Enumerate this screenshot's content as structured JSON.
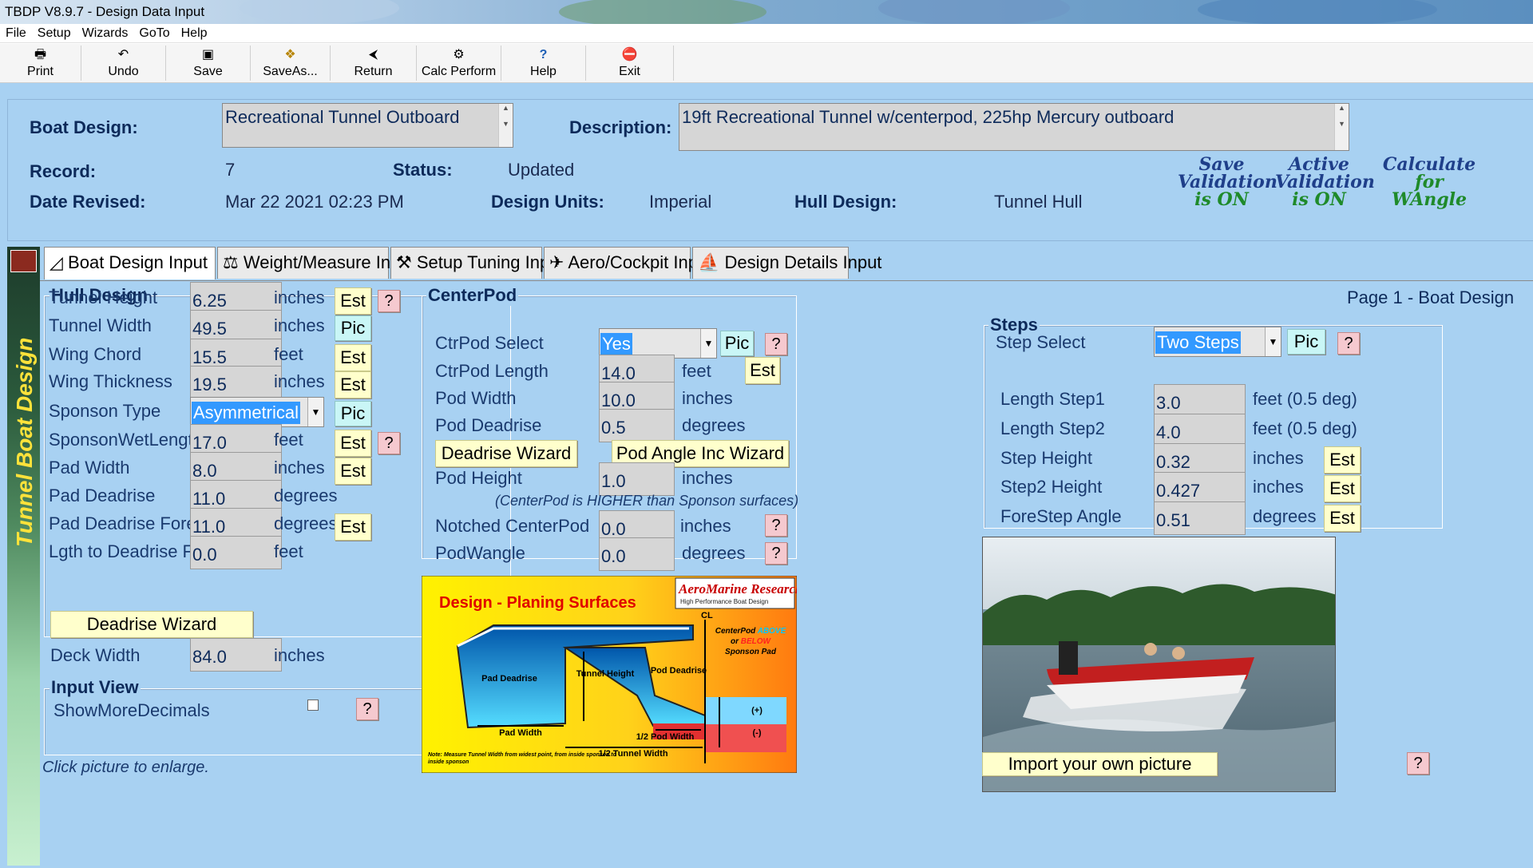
{
  "window": {
    "title": "TBDP V8.9.7 - Design Data Input"
  },
  "menu": [
    "File",
    "Setup",
    "Wizards",
    "GoTo",
    "Help"
  ],
  "toolbar": [
    {
      "label": "Print",
      "icon": "printer-icon",
      "glyph": "🖶"
    },
    {
      "label": "Undo",
      "icon": "undo-icon",
      "glyph": "↶"
    },
    {
      "label": "Save",
      "icon": "save-icon",
      "glyph": "▣"
    },
    {
      "label": "SaveAs...",
      "icon": "saveas-icon",
      "glyph": "❖"
    },
    {
      "label": "Return",
      "icon": "return-icon",
      "glyph": "⮜"
    },
    {
      "label": "Calc Perform",
      "icon": "calc-icon",
      "glyph": "⚙"
    },
    {
      "label": "Help",
      "icon": "help-icon",
      "glyph": "?"
    },
    {
      "label": "Exit",
      "icon": "exit-icon",
      "glyph": "⛔"
    }
  ],
  "header": {
    "boat_design_label": "Boat Design:",
    "boat_design_value": "Recreational Tunnel Outboard",
    "description_label": "Description:",
    "description_value": "19ft Recreational Tunnel w/centerpod, 225hp Mercury outboard",
    "record_label": "Record:",
    "record_value": "7",
    "status_label": "Status:",
    "status_value": "Updated",
    "date_label": "Date Revised:",
    "date_value": "Mar 22 2021 02:23 PM",
    "units_label": "Design Units:",
    "units_value": "Imperial",
    "hull_label": "Hull Design:",
    "hull_value": "Tunnel Hull",
    "indicators": [
      {
        "line1": "Save",
        "line2": "Validation",
        "line3": "is ON"
      },
      {
        "line1": "Active",
        "line2": "Validation",
        "line3": "is ON"
      },
      {
        "line1": "Calculate",
        "line2": "for",
        "line3": "WAngle"
      }
    ]
  },
  "sidebar": {
    "title": "Tunnel Boat Design"
  },
  "tabs": [
    "Boat Design Input",
    "Weight/Measure Input",
    "Setup Tuning Input",
    "Aero/Cockpit Input",
    "Design Details Input"
  ],
  "page_label": "Page 1 - Boat Design",
  "hull": {
    "title": "Hull Design",
    "rows": [
      {
        "label": "Tunnel Height",
        "value": "6.25",
        "unit": "inches",
        "btn": "Est",
        "help": true
      },
      {
        "label": "Tunnel Width",
        "value": "49.5",
        "unit": "inches",
        "btn": "Pic",
        "help": false
      },
      {
        "label": "Wing Chord",
        "value": "15.5",
        "unit": "feet",
        "btn": "Est",
        "help": false
      },
      {
        "label": "Wing Thickness",
        "value": "19.5",
        "unit": "inches",
        "btn": "Est",
        "help": false
      },
      {
        "label": "Sponson Type",
        "value": "Asymmetrical",
        "unit": "",
        "btn": "Pic",
        "help": false
      },
      {
        "label": "SponsonWetLength",
        "value": "17.0",
        "unit": "feet",
        "btn": "Est",
        "help": true
      },
      {
        "label": "Pad Width",
        "value": "8.0",
        "unit": "inches",
        "btn": "Est",
        "help": false
      },
      {
        "label": "Pad Deadrise",
        "value": "11.0",
        "unit": "degrees",
        "btn": "",
        "help": false
      },
      {
        "label": "Pad Deadrise Fore",
        "value": "11.0",
        "unit": "degrees",
        "btn": "Est",
        "help": false
      },
      {
        "label": "Lgth to Deadrise Fore",
        "value": "0.0",
        "unit": "feet",
        "btn": "",
        "help": false
      }
    ],
    "wizard": "Deadrise Wizard",
    "deck_label": "Deck Width",
    "deck_value": "84.0",
    "deck_unit": "inches"
  },
  "input_view": {
    "title": "Input View",
    "label": "ShowMoreDecimals",
    "checked": false
  },
  "footer_note": "Click picture to enlarge.",
  "centerpod": {
    "title": "CenterPod",
    "select_label": "CtrPod Select",
    "select_value": "Yes",
    "select_btn": "Pic",
    "length_label": "CtrPod Length",
    "length_value": "14.0",
    "length_unit": "feet",
    "length_btn": "Est",
    "width_label": "Pod Width",
    "width_value": "10.0",
    "width_unit": "inches",
    "deadrise_label": "Pod Deadrise",
    "deadrise_value": "0.5",
    "deadrise_unit": "degrees",
    "wizard1": "Deadrise Wizard",
    "wizard2": "Pod Angle Inc Wizard",
    "height_label": "Pod Height",
    "height_value": "1.0",
    "height_unit": "inches",
    "note": "(CenterPod is HIGHER than Sponson surfaces)",
    "notched_label": "Notched CenterPod",
    "notched_value": "0.0",
    "notched_unit": "inches",
    "wangle_label": "PodWangle",
    "wangle_value": "0.0",
    "wangle_unit": "degrees"
  },
  "diagram": {
    "title": "Design - Planing Surfaces",
    "brand": "AeroMarine Research",
    "brand_sub": "High Performance Boat Design",
    "labels": {
      "pad_deadrise": "Pad Deadrise",
      "tunnel_height": "Tunnel Height",
      "pod_deadrise": "Pod Deadrise",
      "pad_width": "Pad Width",
      "half_pod": "1/2 Pod Width",
      "half_tunnel": "1/2 Tunnel Width",
      "cl": "CL",
      "above1": "CenterPod",
      "above2": "ABOVE",
      "above3": "or",
      "above4": "BELOW",
      "above5": "Sponson Pad",
      "plus": "(+)",
      "minus": "(-)",
      "note": "Note: Measure Tunnel Width from widest point, from inside sponson to inside sponson"
    }
  },
  "steps": {
    "title": "Steps",
    "select_label": "Step Select",
    "select_value": "Two Steps",
    "select_btn": "Pic",
    "rows": [
      {
        "label": "Length Step1",
        "value": "3.0",
        "unit": "feet (0.5 deg)",
        "btn": ""
      },
      {
        "label": "Length Step2",
        "value": "4.0",
        "unit": "feet (0.5 deg)",
        "btn": ""
      },
      {
        "label": "Step Height",
        "value": "0.32",
        "unit": "inches",
        "btn": "Est"
      },
      {
        "label": "Step2 Height",
        "value": "0.427",
        "unit": "inches",
        "btn": "Est"
      },
      {
        "label": "ForeStep Angle",
        "value": "0.51",
        "unit": "degrees",
        "btn": "Est"
      }
    ]
  },
  "photo": {
    "import_btn": "Import your own picture"
  },
  "colors": {
    "panel": "#a8d1f2",
    "label": "#1a3a6e",
    "button_yellow": "#ffffcc",
    "button_cyan": "#c9f6f6",
    "help_pink": "#f5c9cf",
    "select_blue": "#3399ff"
  }
}
